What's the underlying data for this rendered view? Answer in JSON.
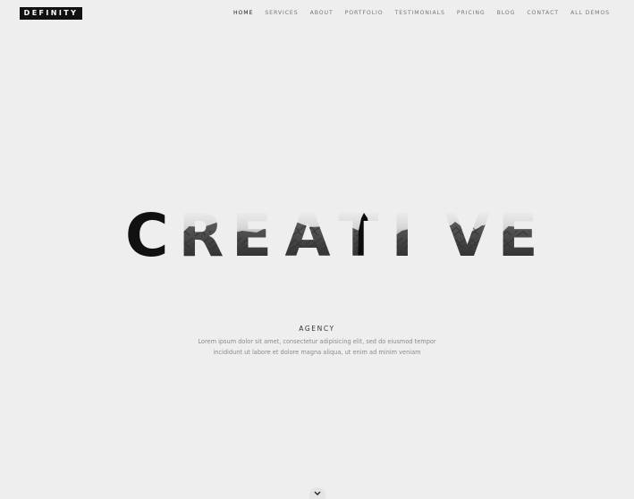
{
  "header": {
    "logo": "DEFINITY",
    "nav": [
      "HOME",
      "SERVICES",
      "ABOUT",
      "PORTFOLIO",
      "TESTIMONIALS",
      "PRICING",
      "BLOG",
      "CONTACT",
      "ALL DEMOS"
    ],
    "active_nav": "HOME"
  },
  "hero": {
    "title": "CREATIVE",
    "subtitle": "AGENCY",
    "description_line1": "Lorem ipsum dolor sit amet, consectetur adipisicing elit, sed do eiusmod tempor",
    "description_line2": "incididunt ut labore et dolore magna aliqua, ut enim ad minim veniam"
  },
  "icons": {
    "scroll": "chevron-down-icon"
  },
  "colors": {
    "background": "#eeeeee",
    "logo_bg": "#111111",
    "title_dark": "#111111",
    "nav_text": "#777777",
    "nav_active": "#222222"
  }
}
